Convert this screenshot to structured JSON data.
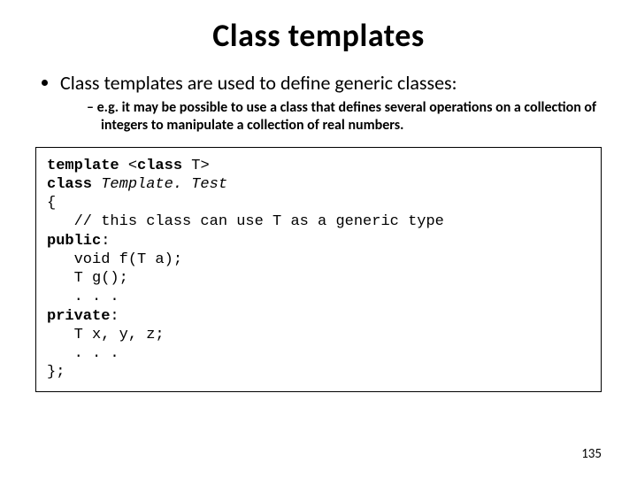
{
  "title": "Class templates",
  "bullet1": "Class templates are used to define generic classes:",
  "bullet1_sub1": "e.g. it may be possible to use a class that defines several operations on a collection of integers to manipulate a collection of real numbers.",
  "code": {
    "l1a": "template",
    "l1b": " <",
    "l1c": "class",
    "l1d": " T>",
    "l2a": "class",
    "l2b": " ",
    "l2c": "Template. Test",
    "l3": "{",
    "l4": "   // this class can use T as a generic type",
    "l5": "public",
    "l5b": ":",
    "l6": "   void f(T a);",
    "l7": "   T g();",
    "l8": "   . . .",
    "l9": "private",
    "l9b": ":",
    "l10": "   T x, y, z;",
    "l11": "   . . .",
    "l12": "};"
  },
  "page_number": "135"
}
